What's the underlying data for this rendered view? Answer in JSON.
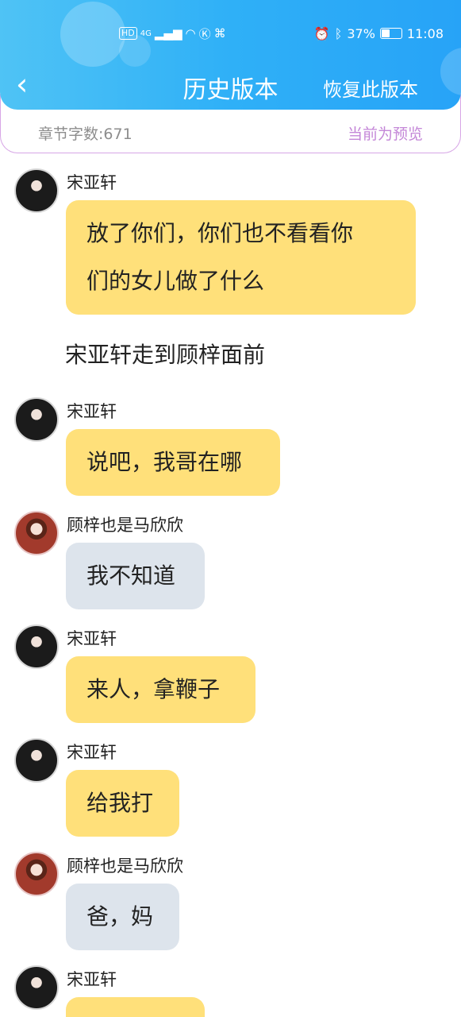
{
  "status_bar": {
    "hd": "HD",
    "network": "4G",
    "battery": "37%",
    "battery_level": 0.37,
    "time": "11:08"
  },
  "header": {
    "title": "历史版本",
    "restore_label": "恢复此版本"
  },
  "info_bar": {
    "word_count": "章节字数:671",
    "preview_label": "当前为预览"
  },
  "colors": {
    "header_gradient_start": "#4fc3f5",
    "header_gradient_end": "#27a3f7",
    "bubble_yellow": "#ffe07a",
    "bubble_grey": "#dde4ec",
    "preview_purple": "#c487d8"
  },
  "chat": [
    {
      "type": "message",
      "speaker": "宋亚轩",
      "avatar": "male",
      "color": "yellow",
      "text_lines": [
        "放了你们，你们也不看看你",
        "们的女儿做了什么"
      ]
    },
    {
      "type": "narration",
      "text": "宋亚轩走到顾梓面前"
    },
    {
      "type": "message",
      "speaker": "宋亚轩",
      "avatar": "male",
      "color": "yellow",
      "text_lines": [
        "说吧，我哥在哪"
      ]
    },
    {
      "type": "message",
      "speaker": "顾梓也是马欣欣",
      "avatar": "female",
      "color": "grey",
      "text_lines": [
        "我不知道"
      ]
    },
    {
      "type": "message",
      "speaker": "宋亚轩",
      "avatar": "male",
      "color": "yellow",
      "text_lines": [
        "来人，拿鞭子"
      ]
    },
    {
      "type": "message",
      "speaker": "宋亚轩",
      "avatar": "male",
      "color": "yellow",
      "text_lines": [
        "给我打"
      ]
    },
    {
      "type": "message",
      "speaker": "顾梓也是马欣欣",
      "avatar": "female",
      "color": "grey",
      "text_lines": [
        "爸，妈"
      ]
    },
    {
      "type": "message",
      "speaker": "宋亚轩",
      "avatar": "male",
      "color": "yellow",
      "text_lines": [
        ""
      ]
    }
  ]
}
